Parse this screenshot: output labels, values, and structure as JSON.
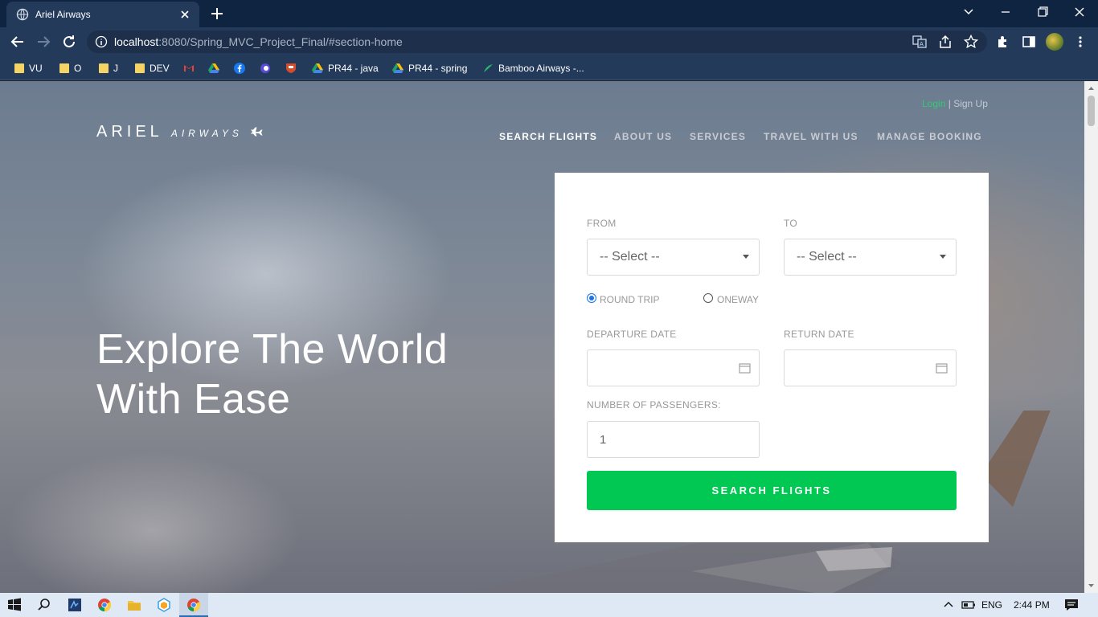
{
  "browser": {
    "tab_title": "Ariel Airways",
    "url_host": "localhost",
    "url_path": ":8080/Spring_MVC_Project_Final/#section-home",
    "bookmarks": [
      {
        "label": "VU",
        "icon": "folder-icon"
      },
      {
        "label": "O",
        "icon": "folder-icon"
      },
      {
        "label": "J",
        "icon": "folder-icon"
      },
      {
        "label": "DEV",
        "icon": "folder-icon"
      },
      {
        "label": "",
        "icon": "gmail-icon"
      },
      {
        "label": "",
        "icon": "drive-icon"
      },
      {
        "label": "",
        "icon": "facebook-icon"
      },
      {
        "label": "",
        "icon": "app-icon"
      },
      {
        "label": "",
        "icon": "crest-icon"
      },
      {
        "label": "PR44 - java",
        "icon": "drive-icon"
      },
      {
        "label": "PR44 - spring",
        "icon": "drive-icon"
      },
      {
        "label": "Bamboo Airways -...",
        "icon": "bamboo-icon"
      }
    ]
  },
  "site": {
    "logo_main": "ARIEL",
    "logo_sub": "AIRWAYS",
    "auth": {
      "login": "Login",
      "separator": "|",
      "signup": "Sign Up"
    },
    "nav": [
      "SEARCH FLIGHTS",
      "ABOUT US",
      "SERVICES",
      "TRAVEL WITH US",
      "MANAGE BOOKING"
    ],
    "headline_line1": "Explore The World",
    "headline_line2": "With Ease"
  },
  "booking": {
    "from_label": "FROM",
    "to_label": "TO",
    "from_value": "-- Select --",
    "to_value": "-- Select --",
    "trip_types": [
      {
        "label": "ROUND TRIP",
        "checked": true
      },
      {
        "label": "ONEWAY",
        "checked": false
      }
    ],
    "departure_label": "DEPARTURE DATE",
    "return_label": "RETURN DATE",
    "passengers_label": "NUMBER OF PASSENGERS:",
    "passengers_value": "1",
    "search_button": "SEARCH FLIGHTS"
  },
  "taskbar": {
    "language": "ENG",
    "time": "2:44 PM"
  },
  "colors": {
    "accent_green": "#00c853",
    "login_green": "#2ecc71",
    "chrome_dark": "#233a5b"
  }
}
